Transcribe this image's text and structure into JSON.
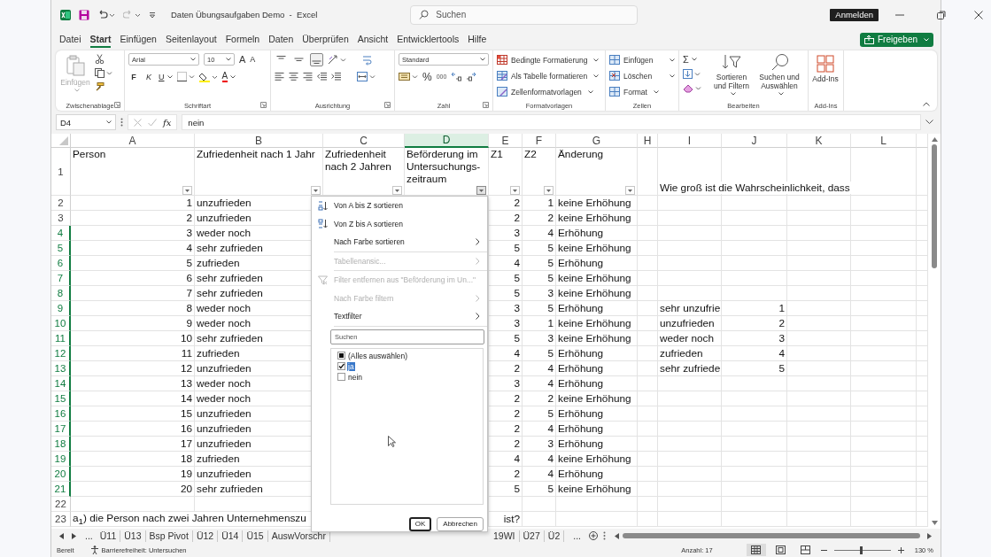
{
  "window": {
    "title": "Daten Übungsaufgaben Demo  -  Excel",
    "search_placeholder": "Suchen",
    "account_button": "Anmelden"
  },
  "menu_tabs": [
    {
      "label": "Datei",
      "selected": false
    },
    {
      "label": "Start",
      "selected": true
    },
    {
      "label": "Einfügen",
      "selected": false
    },
    {
      "label": "Seitenlayout",
      "selected": false
    },
    {
      "label": "Formeln",
      "selected": false
    },
    {
      "label": "Daten",
      "selected": false
    },
    {
      "label": "Überprüfen",
      "selected": false
    },
    {
      "label": "Ansicht",
      "selected": false
    },
    {
      "label": "Entwicklertools",
      "selected": false
    },
    {
      "label": "Hilfe",
      "selected": false
    }
  ],
  "share_button": "Freigeben",
  "ribbon": {
    "clipboard": {
      "paste": "Einfügen",
      "label": "Zwischenablage"
    },
    "font": {
      "name": "Arial",
      "size": "10",
      "grow": "A",
      "shrink": "A",
      "bold": "F",
      "italic": "K",
      "underline": "U",
      "font_color": "A",
      "label": "Schriftart"
    },
    "alignment": {
      "vertical_align": [
        {
          "selected": false
        },
        {
          "selected": false
        },
        {
          "selected": true
        }
      ],
      "label": "Ausrichtung"
    },
    "number": {
      "format": "Standard",
      "percent": "%",
      "thousands": "000",
      "label": "Zahl"
    },
    "styles": {
      "items": [
        "Bedingte Formatierung",
        "Als Tabelle formatieren",
        "Zellenformatvorlagen"
      ],
      "label": "Formatvorlagen"
    },
    "cells": {
      "items": [
        "Einfügen",
        "Löschen",
        "Format"
      ],
      "label": "Zellen"
    },
    "editing": {
      "sum": "Σ",
      "sort_filter": "Sortieren und Filtern",
      "find": "Suchen und Auswählen",
      "label": "Bearbeiten"
    },
    "addins": {
      "button": "Add-Ins",
      "label": "Add-Ins"
    }
  },
  "formula_bar": {
    "name_box": "D4",
    "function_button": "fx",
    "formula": "nein"
  },
  "columns": [
    {
      "label": "A",
      "selected": false
    },
    {
      "label": "B",
      "selected": false
    },
    {
      "label": "C",
      "selected": false
    },
    {
      "label": "D",
      "selected": true
    },
    {
      "label": "E",
      "selected": false
    },
    {
      "label": "F",
      "selected": false
    },
    {
      "label": "G",
      "selected": false
    },
    {
      "label": "H",
      "selected": false
    },
    {
      "label": "I",
      "selected": false
    },
    {
      "label": "J",
      "selected": false
    },
    {
      "label": "K",
      "selected": false
    },
    {
      "label": "L",
      "selected": false
    }
  ],
  "header_row": {
    "row": "1",
    "cells": [
      {
        "text": "Person",
        "filter_open": false
      },
      {
        "text": "Zufriedenheit nach 1 Jahr",
        "filter_open": false
      },
      {
        "text": "Zufriedenheit nach 2 Jahren",
        "filter_open": false
      },
      {
        "text": "Beförderung im Untersuchungs-zeitraum",
        "filter_open": true
      },
      {
        "text": "Z1",
        "filter_open": false
      },
      {
        "text": "Z2",
        "filter_open": false
      },
      {
        "text": "Änderung",
        "filter_open": false
      }
    ],
    "column_i": "Wie groß ist die Wahrscheinlichkeit, dass"
  },
  "rows": [
    {
      "row": "2",
      "selected": false,
      "person": "1",
      "satisfaction_year_1": "unzufrieden",
      "z1": "2",
      "z2": "1",
      "change": "keine Erhöhung"
    },
    {
      "row": "3",
      "selected": false,
      "person": "2",
      "satisfaction_year_1": "unzufrieden",
      "z1": "2",
      "z2": "2",
      "change": "keine Erhöhung"
    },
    {
      "row": "4",
      "selected": true,
      "person": "3",
      "satisfaction_year_1": "weder noch",
      "z1": "3",
      "z2": "4",
      "change": "Erhöhung"
    },
    {
      "row": "5",
      "selected": true,
      "person": "4",
      "satisfaction_year_1": "sehr zufrieden",
      "z1": "5",
      "z2": "5",
      "change": "keine Erhöhung"
    },
    {
      "row": "6",
      "selected": true,
      "person": "5",
      "satisfaction_year_1": "zufrieden",
      "z1": "4",
      "z2": "5",
      "change": "Erhöhung"
    },
    {
      "row": "7",
      "selected": true,
      "person": "6",
      "satisfaction_year_1": "sehr zufrieden",
      "z1": "5",
      "z2": "5",
      "change": "keine Erhöhung"
    },
    {
      "row": "8",
      "selected": true,
      "person": "7",
      "satisfaction_year_1": "sehr zufrieden",
      "z1": "5",
      "z2": "3",
      "change": "keine Erhöhung"
    },
    {
      "row": "9",
      "selected": true,
      "person": "8",
      "satisfaction_year_1": "weder noch",
      "z1": "3",
      "z2": "5",
      "change": "Erhöhung",
      "column_i": "sehr unzufrie",
      "column_j": "1"
    },
    {
      "row": "10",
      "selected": true,
      "person": "9",
      "satisfaction_year_1": "weder noch",
      "z1": "3",
      "z2": "1",
      "change": "keine Erhöhung",
      "column_i": "unzufrieden",
      "column_j": "2"
    },
    {
      "row": "11",
      "selected": true,
      "person": "10",
      "satisfaction_year_1": "sehr zufrieden",
      "z1": "5",
      "z2": "3",
      "change": "keine Erhöhung",
      "column_i": "weder noch",
      "column_j": "3"
    },
    {
      "row": "12",
      "selected": true,
      "person": "11",
      "satisfaction_year_1": "zufrieden",
      "z1": "4",
      "z2": "5",
      "change": "Erhöhung",
      "column_i": "zufrieden",
      "column_j": "4"
    },
    {
      "row": "13",
      "selected": true,
      "person": "12",
      "satisfaction_year_1": "unzufrieden",
      "z1": "2",
      "z2": "4",
      "change": "Erhöhung",
      "column_i": "sehr zufriede",
      "column_j": "5"
    },
    {
      "row": "14",
      "selected": true,
      "person": "13",
      "satisfaction_year_1": "weder noch",
      "z1": "3",
      "z2": "4",
      "change": "Erhöhung"
    },
    {
      "row": "15",
      "selected": true,
      "person": "14",
      "satisfaction_year_1": "weder noch",
      "z1": "2",
      "z2": "2",
      "change": "keine Erhöhung"
    },
    {
      "row": "16",
      "selected": true,
      "person": "15",
      "satisfaction_year_1": "unzufrieden",
      "z1": "2",
      "z2": "5",
      "change": "Erhöhung"
    },
    {
      "row": "17",
      "selected": true,
      "person": "16",
      "satisfaction_year_1": "unzufrieden",
      "z1": "2",
      "z2": "4",
      "change": "Erhöhung"
    },
    {
      "row": "18",
      "selected": true,
      "person": "17",
      "satisfaction_year_1": "unzufrieden",
      "z1": "2",
      "z2": "3",
      "change": "Erhöhung"
    },
    {
      "row": "19",
      "selected": true,
      "person": "18",
      "satisfaction_year_1": "zufrieden",
      "z1": "4",
      "z2": "4",
      "change": "keine Erhöhung"
    },
    {
      "row": "20",
      "selected": true,
      "person": "19",
      "satisfaction_year_1": "unzufrieden",
      "z1": "2",
      "z2": "4",
      "change": "Erhöhung"
    },
    {
      "row": "21",
      "selected": true,
      "person": "20",
      "satisfaction_year_1": "sehr zufrieden",
      "z1": "5",
      "z2": "5",
      "change": "keine Erhöhung"
    },
    {
      "row": "22",
      "selected": false
    },
    {
      "row": "23",
      "selected": false,
      "question_start": "a$_{1}$) die Person nach zwei Jahren Unternehmenszu",
      "question_end": "ist?"
    }
  ],
  "filter_menu": {
    "items": [
      {
        "kind": "sort-ascending",
        "label": "Von A bis Z sortieren",
        "disabled": false,
        "submenu": false,
        "divider_after": false
      },
      {
        "kind": "sort-descending",
        "label": "Von Z bis A sortieren",
        "disabled": false,
        "submenu": false,
        "divider_after": false
      },
      {
        "kind": "plain",
        "label": "Nach Farbe sortieren",
        "disabled": false,
        "submenu": true,
        "divider_after": true
      },
      {
        "kind": "plain",
        "label": "Tabellenansic...",
        "disabled": true,
        "submenu": true,
        "divider_after": true
      },
      {
        "kind": "clear-filter",
        "label": "Filter entfernen aus \"Beförderung im Un...\"",
        "disabled": true,
        "submenu": false,
        "divider_after": false
      },
      {
        "kind": "plain",
        "label": "Nach Farbe filtern",
        "disabled": true,
        "submenu": true,
        "divider_after": false
      },
      {
        "kind": "plain",
        "label": "Textfilter",
        "disabled": false,
        "submenu": true,
        "divider_after": true
      }
    ],
    "search_placeholder": "Suchen",
    "values": [
      {
        "label": "(Alles auswählen)",
        "checked": false,
        "indeterminate": true,
        "selected": false
      },
      {
        "label": "ja",
        "checked": true,
        "indeterminate": false,
        "selected": true
      },
      {
        "label": "nein",
        "checked": false,
        "indeterminate": false,
        "selected": false
      }
    ],
    "buttons": [
      {
        "label": "OK",
        "default": true
      },
      {
        "label": "Abbrechen",
        "default": false
      }
    ]
  },
  "sheet_tabs": {
    "overflow": "...",
    "before_menu": [
      {
        "label": "Ü11",
        "selected": false
      },
      {
        "label": "Ü13",
        "selected": false
      },
      {
        "label": "Bsp Pivot",
        "selected": false
      },
      {
        "label": "Ü12",
        "selected": false
      },
      {
        "label": "Ü14",
        "selected": false
      },
      {
        "label": "Ü15",
        "selected": false
      },
      {
        "label": "AuswVorschr",
        "selected": false
      }
    ],
    "after_menu": [
      {
        "label": "19WI",
        "selected": false
      },
      {
        "label": "Ü27",
        "selected": false
      },
      {
        "label": "Ü2",
        "selected": false
      }
    ],
    "overflow_right": "..."
  },
  "status_bar": {
    "mode": "Bereit",
    "accessibility": "Barrierefreiheit: Untersuchen",
    "count": "Anzahl: 17",
    "views": [
      {
        "selected": true
      },
      {
        "selected": false
      },
      {
        "selected": false
      }
    ],
    "zoom_slider": {
      "level": 0.48
    },
    "zoom": "130 %"
  }
}
